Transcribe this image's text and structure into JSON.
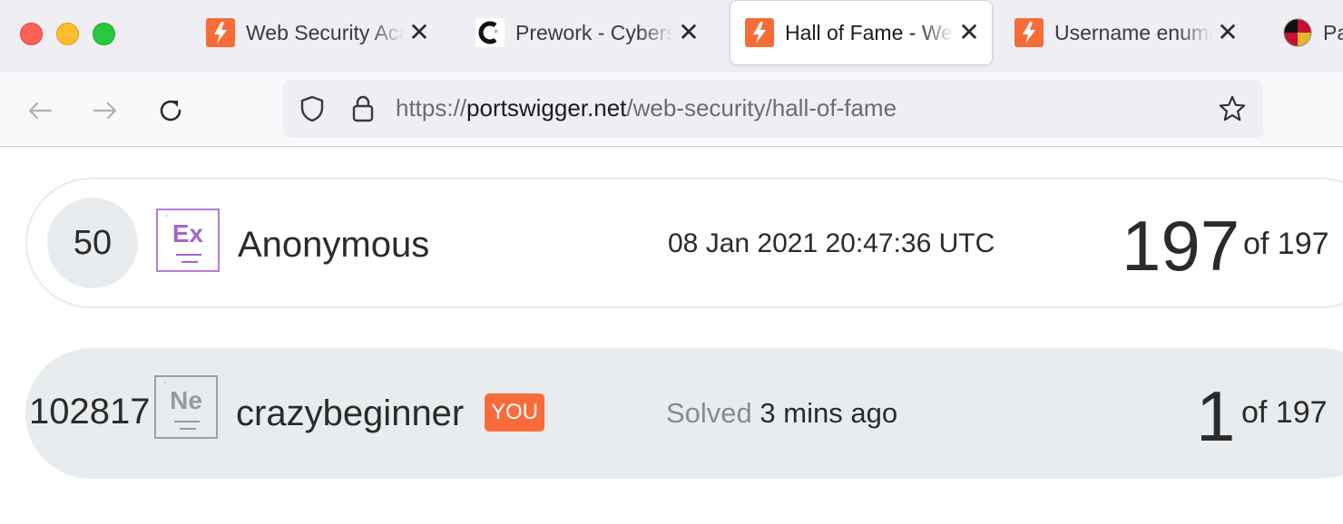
{
  "browser": {
    "tabs": [
      {
        "title": "Web Security Academy",
        "favicon": "portswigger-logo-icon",
        "active": false
      },
      {
        "title": "Prework - Cybersecurity",
        "favicon": "codepath-logo-icon",
        "active": false
      },
      {
        "title": "Hall of Fame - Web Security Academy",
        "favicon": "portswigger-logo-icon",
        "active": true
      },
      {
        "title": "Username enumeration",
        "favicon": "portswigger-logo-icon",
        "active": false
      },
      {
        "title": "Pa",
        "favicon": "maryland-flag-icon",
        "active": false
      }
    ],
    "url": {
      "scheme": "https://",
      "host": "portswigger.net",
      "path": "/web-security/hall-of-fame"
    }
  },
  "leaderboard": {
    "rows": [
      {
        "rank": "50",
        "badge": "Ex",
        "username": "Anonymous",
        "date": "08 Jan 2021 20:47:36 UTC",
        "score": "197",
        "score_total": "of 197"
      },
      {
        "rank": "102817",
        "badge": "Ne",
        "username": "crazybeginner",
        "you_label": "YOU",
        "solved_label": "Solved",
        "solved_time": "3 mins ago",
        "score": "1",
        "score_total": "of 197"
      }
    ]
  },
  "colors": {
    "accent": "#f86c3a",
    "expert_badge": "#a466c9",
    "newbie_badge": "#9a9a9a"
  }
}
